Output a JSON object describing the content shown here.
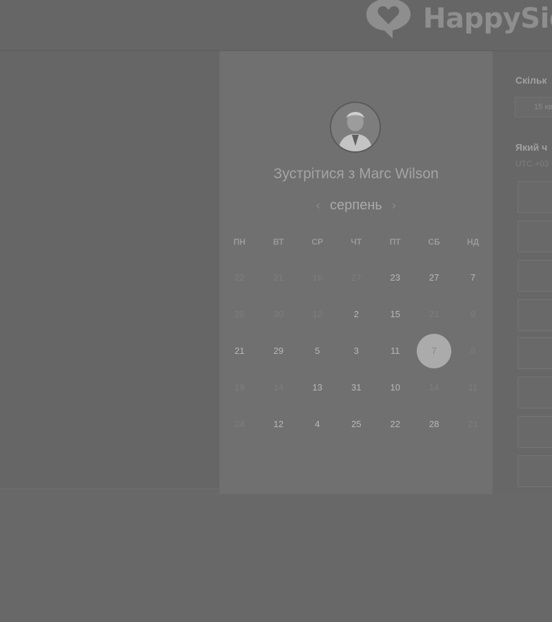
{
  "brand": {
    "name": "HappySig",
    "icon": "heart-speech-bubble-icon"
  },
  "meeting": {
    "title": "Зустрітися з Marc Wilson"
  },
  "calendar": {
    "month": "серпень",
    "prev_icon": "chevron-left-icon",
    "next_icon": "chevron-right-icon",
    "weekdays": [
      "ПН",
      "ВТ",
      "СР",
      "ЧТ",
      "ПТ",
      "СБ",
      "НД"
    ],
    "weeks": [
      [
        {
          "d": "22",
          "a": false
        },
        {
          "d": "21",
          "a": false
        },
        {
          "d": "16",
          "a": false
        },
        {
          "d": "27",
          "a": false
        },
        {
          "d": "23",
          "a": true
        },
        {
          "d": "27",
          "a": true
        },
        {
          "d": "7",
          "a": true
        }
      ],
      [
        {
          "d": "26",
          "a": false
        },
        {
          "d": "30",
          "a": false
        },
        {
          "d": "12",
          "a": false
        },
        {
          "d": "2",
          "a": true
        },
        {
          "d": "15",
          "a": true
        },
        {
          "d": "21",
          "a": false
        },
        {
          "d": "9",
          "a": false
        }
      ],
      [
        {
          "d": "21",
          "a": true
        },
        {
          "d": "29",
          "a": true
        },
        {
          "d": "5",
          "a": true
        },
        {
          "d": "3",
          "a": true
        },
        {
          "d": "11",
          "a": true
        },
        {
          "d": "7",
          "a": true,
          "selected": true
        },
        {
          "d": "8",
          "a": false
        }
      ],
      [
        {
          "d": "19",
          "a": false
        },
        {
          "d": "14",
          "a": false
        },
        {
          "d": "13",
          "a": true
        },
        {
          "d": "31",
          "a": true
        },
        {
          "d": "10",
          "a": true
        },
        {
          "d": "14",
          "a": false
        },
        {
          "d": "11",
          "a": false
        }
      ],
      [
        {
          "d": "24",
          "a": false
        },
        {
          "d": "12",
          "a": true
        },
        {
          "d": "4",
          "a": true
        },
        {
          "d": "25",
          "a": true
        },
        {
          "d": "22",
          "a": true
        },
        {
          "d": "28",
          "a": true
        },
        {
          "d": "21",
          "a": false
        }
      ]
    ]
  },
  "sidebar": {
    "duration_label": "Скільк",
    "duration_value": "15 хв",
    "time_label": "Який ч",
    "timezone": "UTC +03"
  },
  "colors": {
    "background": "#686868",
    "selected": "#ababab"
  }
}
